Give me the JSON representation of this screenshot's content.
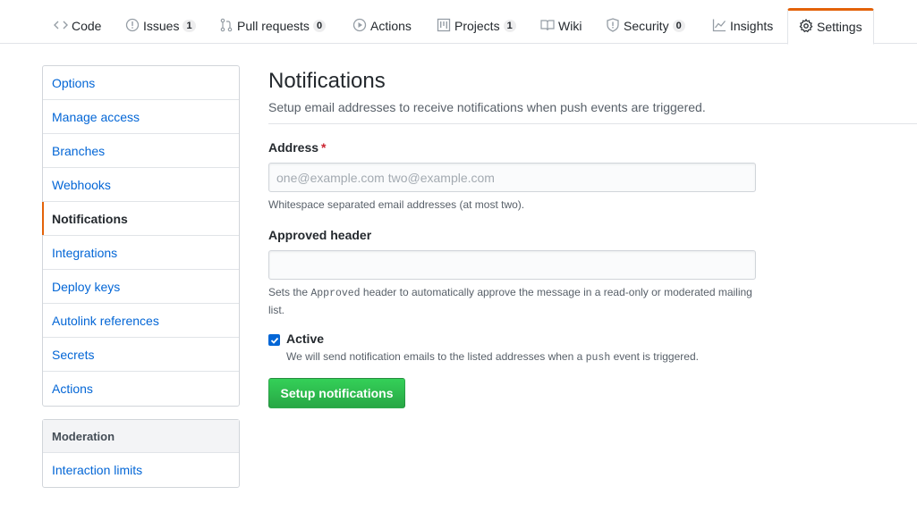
{
  "nav": {
    "items": [
      {
        "label": "Code",
        "icon": "code-icon",
        "counter": ""
      },
      {
        "label": "Issues",
        "icon": "issue-icon",
        "counter": "1"
      },
      {
        "label": "Pull requests",
        "icon": "pull-request-icon",
        "counter": "0"
      },
      {
        "label": "Actions",
        "icon": "play-icon",
        "counter": ""
      },
      {
        "label": "Projects",
        "icon": "project-icon",
        "counter": "1"
      },
      {
        "label": "Wiki",
        "icon": "book-icon",
        "counter": ""
      },
      {
        "label": "Security",
        "icon": "shield-icon",
        "counter": "0"
      },
      {
        "label": "Insights",
        "icon": "graph-icon",
        "counter": ""
      },
      {
        "label": "Settings",
        "icon": "gear-icon",
        "counter": "",
        "selected": true
      }
    ]
  },
  "sidebar": {
    "items": [
      {
        "label": "Options"
      },
      {
        "label": "Manage access"
      },
      {
        "label": "Branches"
      },
      {
        "label": "Webhooks"
      },
      {
        "label": "Notifications",
        "selected": true
      },
      {
        "label": "Integrations"
      },
      {
        "label": "Deploy keys"
      },
      {
        "label": "Autolink references"
      },
      {
        "label": "Secrets"
      },
      {
        "label": "Actions"
      }
    ],
    "moderation": {
      "heading": "Moderation",
      "items": [
        {
          "label": "Interaction limits"
        }
      ]
    }
  },
  "main": {
    "title": "Notifications",
    "description": "Setup email addresses to receive notifications when push events are triggered.",
    "address": {
      "label": "Address",
      "required_mark": "*",
      "value": "",
      "placeholder": "one@example.com two@example.com",
      "note": "Whitespace separated email addresses (at most two)."
    },
    "approved_header": {
      "label": "Approved header",
      "value": "",
      "note_before": "Sets the ",
      "note_code": "Approved",
      "note_after": " header to automatically approve the message in a read-only or moderated mailing list."
    },
    "active": {
      "checked": true,
      "label": "Active",
      "note_before": "We will send notification emails to the listed addresses when a ",
      "note_code": "push",
      "note_after": " event is triggered."
    },
    "submit_label": "Setup notifications"
  },
  "colors": {
    "accent": "#e36209",
    "link": "#0366d6",
    "button": "#28a745"
  }
}
